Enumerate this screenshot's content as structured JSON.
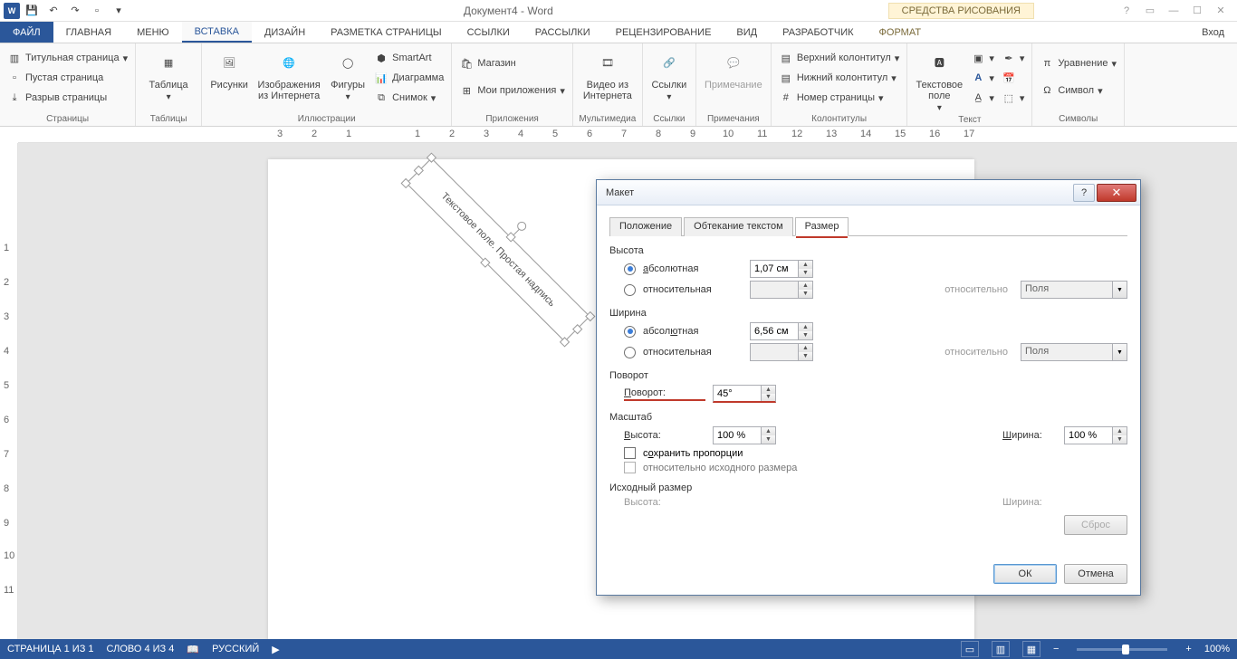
{
  "titlebar": {
    "title": "Документ4 - Word",
    "context_tools": "СРЕДСТВА РИСОВАНИЯ"
  },
  "tabs": {
    "file": "ФАЙЛ",
    "home": "ГЛАВНАЯ",
    "menu": "Меню",
    "insert": "ВСТАВКА",
    "design": "ДИЗАЙН",
    "layout": "РАЗМЕТКА СТРАНИЦЫ",
    "refs": "ССЫЛКИ",
    "mail": "РАССЫЛКИ",
    "review": "РЕЦЕНЗИРОВАНИЕ",
    "view": "ВИД",
    "dev": "РАЗРАБОТЧИК",
    "format": "ФОРМАТ",
    "signin": "Вход"
  },
  "ribbon": {
    "pages": {
      "cover": "Титульная страница",
      "blank": "Пустая страница",
      "break": "Разрыв страницы",
      "label": "Страницы"
    },
    "tables": {
      "btn": "Таблица",
      "label": "Таблицы"
    },
    "illus": {
      "pics": "Рисунки",
      "online": "Изображения из Интернета",
      "shapes": "Фигуры",
      "smartart": "SmartArt",
      "chart": "Диаграмма",
      "shot": "Снимок",
      "label": "Иллюстрации"
    },
    "apps": {
      "store": "Магазин",
      "myapps": "Мои приложения",
      "label": "Приложения"
    },
    "media": {
      "video": "Видео из Интернета",
      "label": "Мультимедиа"
    },
    "links": {
      "link": "Ссылки",
      "label": "Ссылки"
    },
    "comments": {
      "btn": "Примечание",
      "label": "Примечания"
    },
    "hf": {
      "header": "Верхний колонтитул",
      "footer": "Нижний колонтитул",
      "pgnum": "Номер страницы",
      "label": "Колонтитулы"
    },
    "text": {
      "tb": "Текстовое поле",
      "label": "Текст"
    },
    "symbols": {
      "eq": "Уравнение",
      "sym": "Символ",
      "label": "Символы"
    }
  },
  "textbox_content": "Текстовое поле. Простая надпись",
  "dialog": {
    "title": "Макет",
    "tabs": {
      "pos": "Положение",
      "wrap": "Обтекание текстом",
      "size": "Размер"
    },
    "height_h": "Высота",
    "abs": "абсолютная",
    "rel": "относительная",
    "height_val": "1,07 см",
    "rel_to": "относительно",
    "rel_opt": "Поля",
    "width_h": "Ширина",
    "width_val": "6,56 см",
    "rotation_h": "Поворот",
    "rotation_l": "Поворот:",
    "rotation_val": "45°",
    "scale_h": "Масштаб",
    "scale_h_l": "Высота:",
    "scale_h_v": "100 %",
    "scale_w_l": "Ширина:",
    "scale_w_v": "100 %",
    "lock": "сохранить пропорции",
    "rel_orig": "относительно исходного размера",
    "orig_h": "Исходный размер",
    "orig_hl": "Высота:",
    "orig_wl": "Ширина:",
    "reset": "Сброс",
    "ok": "ОК",
    "cancel": "Отмена"
  },
  "status": {
    "page": "СТРАНИЦА 1 ИЗ 1",
    "words": "СЛОВО 4 ИЗ 4",
    "lang": "РУССКИЙ",
    "zoom": "100%"
  }
}
